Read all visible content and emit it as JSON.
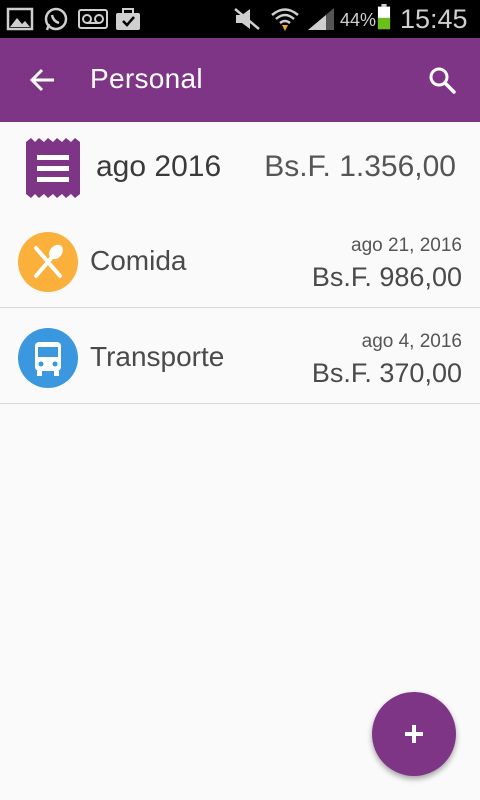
{
  "status_bar": {
    "battery_percent": "44%",
    "time": "15:45",
    "icons": [
      "gallery-icon",
      "whatsapp-icon",
      "voicemail-icon",
      "briefcase-icon",
      "mute-icon",
      "wifi-icon",
      "signal-icon",
      "battery-icon"
    ]
  },
  "app_bar": {
    "title": "Personal",
    "back_icon": "arrow-back-icon",
    "search_icon": "search-icon",
    "color": "#7f3585"
  },
  "summary": {
    "month": "ago 2016",
    "total": "Bs.F. 1.356,00",
    "icon": "receipt-icon"
  },
  "categories": [
    {
      "label": "Comida",
      "date": "ago 21, 2016",
      "amount": "Bs.F. 986,00",
      "icon": "restaurant-icon",
      "color": "#fbb03b"
    },
    {
      "label": "Transporte",
      "date": "ago 4, 2016",
      "amount": "Bs.F. 370,00",
      "icon": "bus-icon",
      "color": "#3b97de"
    }
  ],
  "fab": {
    "label": "+",
    "icon": "add-icon"
  }
}
